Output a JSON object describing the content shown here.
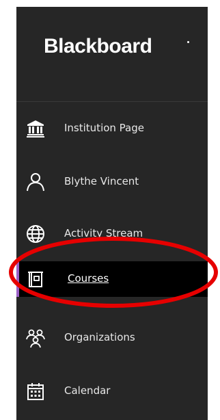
{
  "brand": {
    "logo_text": "Blackboard"
  },
  "nav": {
    "items": [
      {
        "label": "Institution Page",
        "icon": "institution-icon"
      },
      {
        "label": "Blythe Vincent",
        "icon": "user-icon"
      },
      {
        "label": "Activity Stream",
        "icon": "globe-icon"
      },
      {
        "label": "Courses",
        "icon": "courses-icon",
        "active": true
      },
      {
        "label": "Organizations",
        "icon": "organizations-icon"
      },
      {
        "label": "Calendar",
        "icon": "calendar-icon"
      }
    ]
  },
  "colors": {
    "sidebar_bg": "#262626",
    "active_bg": "#000000",
    "active_accent": "#9b5fc6",
    "annotation": "#e60000"
  }
}
